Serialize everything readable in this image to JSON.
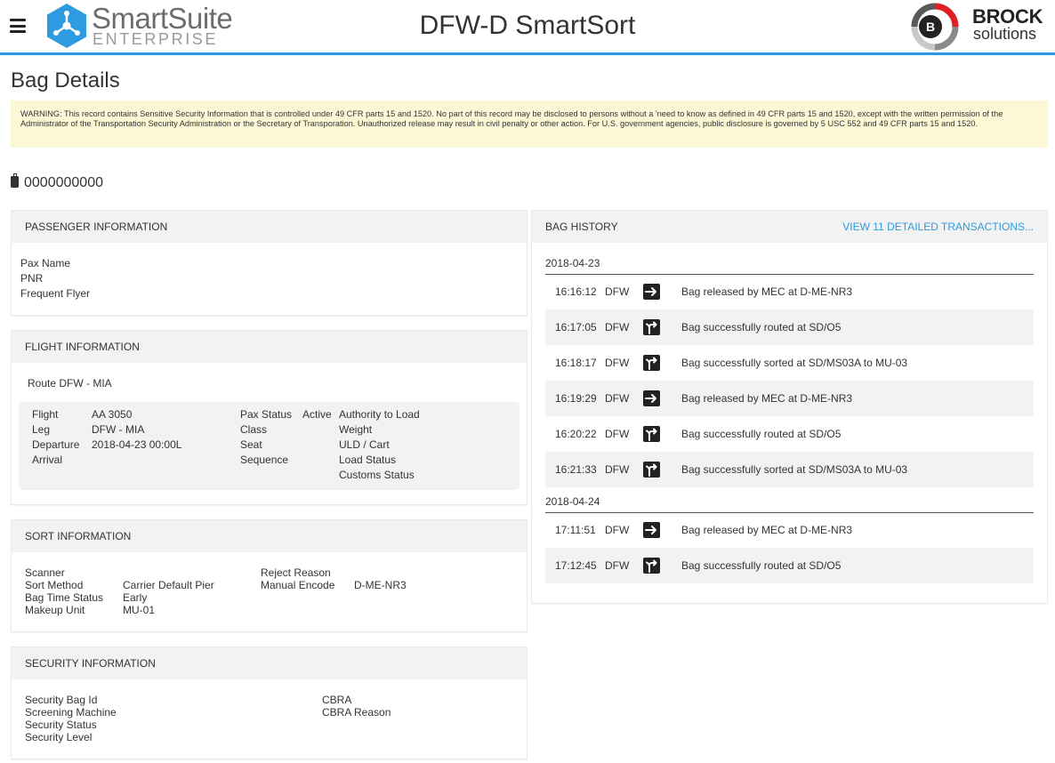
{
  "header": {
    "logo_word1": "SmartSuite",
    "logo_word2": "ENTERPRISE",
    "app_title": "DFW-D SmartSort",
    "brand_word1": "BROCK",
    "brand_word2": "solutions",
    "brand_badge": "B",
    "accent_color": "#2e9be0"
  },
  "page": {
    "title": "Bag Details",
    "warning": "WARNING: This record contains Sensitive Security Information that is controlled under 49 CFR parts 15 and 1520. No part of this record may be disclosed to persons without a 'need to know as defined in 49 CFR parts 15 and 1520, except with the written permission of the Administrator of the Transportation Security Administration or the Secretary of Transporation. Unauthorized release may result in civil penalty or other action. For U.S. government agencies, public disclosure is governed by 5 USC 552 and 49 CFR parts 15 and 1520.",
    "bag_id": "0000000000"
  },
  "passenger": {
    "heading": "PASSENGER INFORMATION",
    "pax_name": "Pax Name",
    "pnr": "PNR",
    "frequent_flyer": "Frequent Flyer"
  },
  "flight": {
    "heading": "FLIGHT INFORMATION",
    "route": "Route DFW - MIA",
    "labels": {
      "flight": "Flight",
      "leg": "Leg",
      "departure": "Departure",
      "arrival": "Arrival",
      "pax_status": "Pax Status",
      "class": "Class",
      "seat": "Seat",
      "sequence": "Sequence",
      "authority": "Authority to Load",
      "weight": "Weight",
      "uld": "ULD / Cart",
      "load_status": "Load Status",
      "customs_status": "Customs Status"
    },
    "values": {
      "flight": "AA 3050",
      "leg": "DFW - MIA",
      "departure": "2018-04-23 00:00L",
      "pax_status": "Active"
    }
  },
  "sort": {
    "heading": "SORT INFORMATION",
    "labels": {
      "scanner": "Scanner",
      "sort_method": "Sort Method",
      "bag_time_status": "Bag Time Status",
      "makeup_unit": "Makeup Unit",
      "reject_reason": "Reject Reason",
      "manual_encode": "Manual Encode"
    },
    "values": {
      "sort_method": "Carrier Default Pier",
      "bag_time_status": "Early",
      "makeup_unit": "MU-01",
      "manual_encode": "D-ME-NR3"
    }
  },
  "security": {
    "heading": "SECURITY INFORMATION",
    "labels": {
      "security_bag_id": "Security Bag Id",
      "screening_machine": "Screening Machine",
      "security_status": "Security Status",
      "security_level": "Security Level",
      "cbra": "CBRA",
      "cbra_reason": "CBRA Reason"
    }
  },
  "history": {
    "heading": "BAG HISTORY",
    "link": "View 11 Detailed Transactions...",
    "groups": [
      {
        "date": "2018-04-23",
        "rows": [
          {
            "time": "16:16:12",
            "loc": "DFW",
            "icon": "arrow-right-icon",
            "msg": "Bag released by MEC at D-ME-NR3"
          },
          {
            "time": "16:17:05",
            "loc": "DFW",
            "icon": "route-split-icon",
            "msg": "Bag successfully routed at SD/O5"
          },
          {
            "time": "16:18:17",
            "loc": "DFW",
            "icon": "route-split-icon",
            "msg": "Bag successfully sorted at SD/MS03A to MU-03"
          },
          {
            "time": "16:19:29",
            "loc": "DFW",
            "icon": "arrow-right-icon",
            "msg": "Bag released by MEC at D-ME-NR3"
          },
          {
            "time": "16:20:22",
            "loc": "DFW",
            "icon": "route-split-icon",
            "msg": "Bag successfully routed at SD/O5"
          },
          {
            "time": "16:21:33",
            "loc": "DFW",
            "icon": "route-split-icon",
            "msg": "Bag successfully sorted at SD/MS03A to MU-03"
          }
        ]
      },
      {
        "date": "2018-04-24",
        "rows": [
          {
            "time": "17:11:51",
            "loc": "DFW",
            "icon": "arrow-right-icon",
            "msg": "Bag released by MEC at D-ME-NR3"
          },
          {
            "time": "17:12:45",
            "loc": "DFW",
            "icon": "route-split-icon",
            "msg": "Bag successfully routed at SD/O5"
          }
        ]
      }
    ]
  }
}
